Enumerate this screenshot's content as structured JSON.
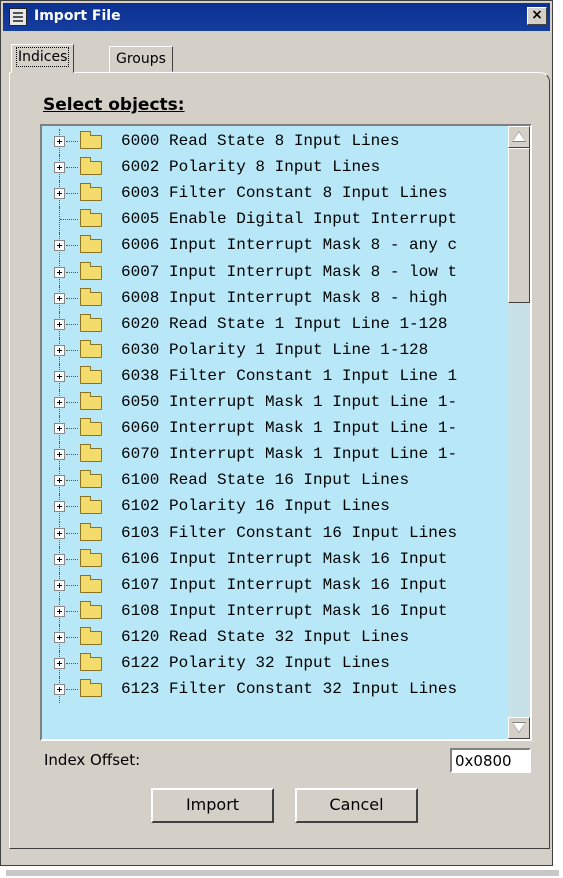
{
  "window": {
    "title": "Import File",
    "close_glyph": "×",
    "accent": "#0a2f92"
  },
  "tabs": [
    {
      "label": "Indices",
      "active": true
    },
    {
      "label": "Groups",
      "active": false
    }
  ],
  "select_label": "Select objects:",
  "list": {
    "background": "#b8e8f8",
    "items": [
      {
        "text": "6000 Read State 8 Input Lines",
        "expandable": true
      },
      {
        "text": "6002 Polarity 8 Input Lines",
        "expandable": true
      },
      {
        "text": "6003 Filter Constant 8 Input Lines",
        "expandable": true
      },
      {
        "text": "6005 Enable Digital Input Interrupt",
        "expandable": false
      },
      {
        "text": "6006 Input Interrupt Mask 8 - any c",
        "expandable": true
      },
      {
        "text": "6007 Input Interrupt Mask 8 - low t",
        "expandable": true
      },
      {
        "text": "6008 Input Interrupt Mask 8 - high",
        "expandable": true
      },
      {
        "text": "6020 Read State 1 Input Line 1-128",
        "expandable": true
      },
      {
        "text": "6030 Polarity 1 Input Line 1-128",
        "expandable": true
      },
      {
        "text": "6038 Filter Constant 1 Input Line 1",
        "expandable": true
      },
      {
        "text": "6050 Interrupt Mask 1 Input Line 1-",
        "expandable": true
      },
      {
        "text": "6060 Interrupt Mask 1 Input Line 1-",
        "expandable": true
      },
      {
        "text": "6070 Interrupt Mask 1 Input Line 1-",
        "expandable": true
      },
      {
        "text": "6100 Read State 16 Input Lines",
        "expandable": true
      },
      {
        "text": "6102 Polarity 16 Input Lines",
        "expandable": true
      },
      {
        "text": "6103 Filter Constant 16 Input Lines",
        "expandable": true
      },
      {
        "text": "6106 Input Interrupt Mask 16 Input",
        "expandable": true
      },
      {
        "text": "6107 Input Interrupt Mask 16 Input",
        "expandable": true
      },
      {
        "text": "6108 Input Interrupt Mask 16 Input",
        "expandable": true
      },
      {
        "text": "6120 Read State 32 Input Lines",
        "expandable": true
      },
      {
        "text": "6122 Polarity 32 Input Lines",
        "expandable": true
      },
      {
        "text": "6123 Filter Constant 32 Input Lines",
        "expandable": true
      }
    ]
  },
  "index_offset": {
    "label": "Index Offset:",
    "value": "0x0800"
  },
  "buttons": {
    "import": "Import",
    "cancel": "Cancel"
  }
}
